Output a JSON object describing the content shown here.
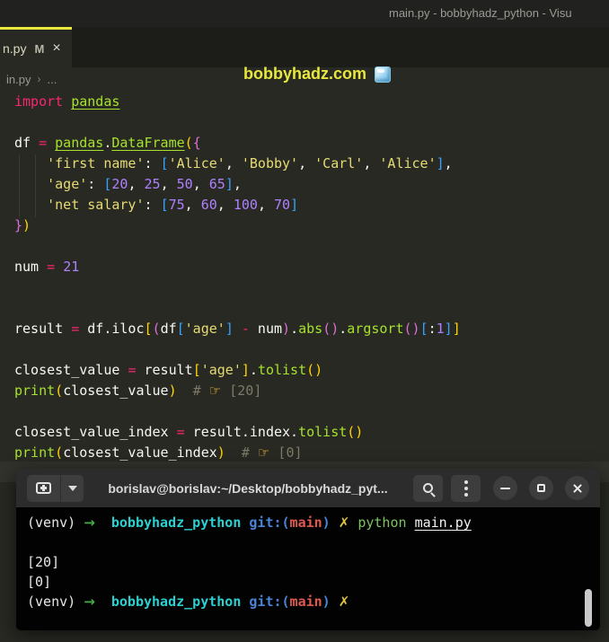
{
  "window": {
    "title": "main.py - bobbyhadz_python - Visu"
  },
  "tab": {
    "label": "n.py",
    "modified_badge": "M",
    "close_glyph": "×"
  },
  "center_title": {
    "text": "bobbyhadz.com",
    "icon": "ice-cube-icon"
  },
  "breadcrumb": {
    "file": "in.py",
    "separator": "›",
    "more": "..."
  },
  "colors": {
    "editor_bg": "#282923",
    "titlebar_bg": "#212220",
    "tabbar_bg": "#1c1d18",
    "tab_accent_yellow": "#e7e73c",
    "watermark_yellow": "#e8e73e",
    "keyword_pink": "#f92672",
    "function_green": "#a6e22e",
    "string_khaki": "#e6db74",
    "number_purple": "#ae81ff",
    "comment_gray": "#7e7a68",
    "bracket_level1_yellow": "#ffd700",
    "bracket_level2_purple": "#d970d6",
    "bracket_level3_blue": "#36a3ff",
    "terminal_bg": "#020202",
    "terminal_header_bg": "#2c2c2c",
    "prompt_arrow_green": "#43b14b",
    "prompt_dir_cyan": "#2bd0d0",
    "prompt_git_blue": "#4a84d4",
    "prompt_branch_red": "#e05a50",
    "prompt_dirty_yellow": "#e2c23f"
  },
  "code": {
    "lines": [
      [
        [
          "kw",
          "import"
        ],
        [
          "pl",
          " "
        ],
        [
          "mod",
          "pandas"
        ]
      ],
      [],
      [
        [
          "pl",
          "df "
        ],
        [
          "op",
          "="
        ],
        [
          "pl",
          " "
        ],
        [
          "mod",
          "pandas"
        ],
        [
          "pl",
          "."
        ],
        [
          "mod",
          "DataFrame"
        ],
        [
          "b1",
          "("
        ],
        [
          "b2",
          "{"
        ]
      ],
      [
        [
          "pl",
          "    "
        ],
        [
          "str",
          "'first name'"
        ],
        [
          "pl",
          ": "
        ],
        [
          "b3",
          "["
        ],
        [
          "str",
          "'Alice'"
        ],
        [
          "pl",
          ", "
        ],
        [
          "str",
          "'Bobby'"
        ],
        [
          "pl",
          ", "
        ],
        [
          "str",
          "'Carl'"
        ],
        [
          "pl",
          ", "
        ],
        [
          "str",
          "'Alice'"
        ],
        [
          "b3",
          "]"
        ],
        [
          "pl",
          ","
        ]
      ],
      [
        [
          "pl",
          "    "
        ],
        [
          "str",
          "'age'"
        ],
        [
          "pl",
          ": "
        ],
        [
          "b3",
          "["
        ],
        [
          "num",
          "20"
        ],
        [
          "pl",
          ", "
        ],
        [
          "num",
          "25"
        ],
        [
          "pl",
          ", "
        ],
        [
          "num",
          "50"
        ],
        [
          "pl",
          ", "
        ],
        [
          "num",
          "65"
        ],
        [
          "b3",
          "]"
        ],
        [
          "pl",
          ","
        ]
      ],
      [
        [
          "pl",
          "    "
        ],
        [
          "str",
          "'net salary'"
        ],
        [
          "pl",
          ": "
        ],
        [
          "b3",
          "["
        ],
        [
          "num",
          "75"
        ],
        [
          "pl",
          ", "
        ],
        [
          "num",
          "60"
        ],
        [
          "pl",
          ", "
        ],
        [
          "num",
          "100"
        ],
        [
          "pl",
          ", "
        ],
        [
          "num",
          "70"
        ],
        [
          "b3",
          "]"
        ]
      ],
      [
        [
          "b2",
          "}"
        ],
        [
          "b1",
          ")"
        ]
      ],
      [],
      [
        [
          "pl",
          "num "
        ],
        [
          "op",
          "="
        ],
        [
          "pl",
          " "
        ],
        [
          "num",
          "21"
        ]
      ],
      [],
      [],
      [
        [
          "pl",
          "result "
        ],
        [
          "op",
          "="
        ],
        [
          "pl",
          " df.iloc"
        ],
        [
          "b1",
          "["
        ],
        [
          "b2",
          "("
        ],
        [
          "pl",
          "df"
        ],
        [
          "b3",
          "["
        ],
        [
          "str",
          "'age'"
        ],
        [
          "b3",
          "]"
        ],
        [
          "pl",
          " "
        ],
        [
          "op",
          "-"
        ],
        [
          "pl",
          " num"
        ],
        [
          "b2",
          ")"
        ],
        [
          "pl",
          "."
        ],
        [
          "fn",
          "abs"
        ],
        [
          "b2",
          "()"
        ],
        [
          "pl",
          "."
        ],
        [
          "fn",
          "argsort"
        ],
        [
          "b2",
          "()"
        ],
        [
          "b3",
          "["
        ],
        [
          "pl",
          ":"
        ],
        [
          "num",
          "1"
        ],
        [
          "b3",
          "]"
        ],
        [
          "b1",
          "]"
        ]
      ],
      [],
      [
        [
          "pl",
          "closest_value "
        ],
        [
          "op",
          "="
        ],
        [
          "pl",
          " result"
        ],
        [
          "b1",
          "["
        ],
        [
          "str",
          "'age'"
        ],
        [
          "b1",
          "]"
        ],
        [
          "pl",
          "."
        ],
        [
          "fn",
          "tolist"
        ],
        [
          "b1",
          "()"
        ]
      ],
      [
        [
          "fn",
          "print"
        ],
        [
          "b1",
          "("
        ],
        [
          "pl",
          "closest_value"
        ],
        [
          "b1",
          ")"
        ],
        [
          "pl",
          "  "
        ],
        [
          "cm",
          "# "
        ],
        [
          "hand",
          "☞"
        ],
        [
          "cm",
          " [20]"
        ]
      ],
      [],
      [
        [
          "pl",
          "closest_value_index "
        ],
        [
          "op",
          "="
        ],
        [
          "pl",
          " result.index."
        ],
        [
          "fn",
          "tolist"
        ],
        [
          "b1",
          "()"
        ]
      ],
      [
        [
          "fn",
          "print"
        ],
        [
          "b1",
          "("
        ],
        [
          "pl",
          "closest_value_index"
        ],
        [
          "b1",
          ")"
        ],
        [
          "pl",
          "  "
        ],
        [
          "cm",
          "# "
        ],
        [
          "hand",
          "☞"
        ],
        [
          "cm",
          " [0]"
        ]
      ]
    ]
  },
  "terminal": {
    "title": "borislav@borislav:~/Desktop/bobbyhadz_pyt...",
    "lines": [
      [
        [
          "w",
          "(venv) "
        ],
        [
          "g",
          "→"
        ],
        [
          "w",
          "  "
        ],
        [
          "cy",
          "bobbyhadz_python"
        ],
        [
          "w",
          " "
        ],
        [
          "bl",
          "git:("
        ],
        [
          "rd",
          "main"
        ],
        [
          "bl",
          ")"
        ],
        [
          "w",
          " "
        ],
        [
          "yl",
          "✗"
        ],
        [
          "w",
          " "
        ],
        [
          "grn",
          "python"
        ],
        [
          "w",
          " "
        ],
        [
          "fu",
          "main.py"
        ]
      ],
      [],
      [
        [
          "w",
          "[20]"
        ]
      ],
      [
        [
          "w",
          "[0]"
        ]
      ],
      [
        [
          "w",
          "(venv) "
        ],
        [
          "g",
          "→"
        ],
        [
          "w",
          "  "
        ],
        [
          "cy",
          "bobbyhadz_python"
        ],
        [
          "w",
          " "
        ],
        [
          "bl",
          "git:("
        ],
        [
          "rd",
          "main"
        ],
        [
          "bl",
          ")"
        ],
        [
          "w",
          " "
        ],
        [
          "yl",
          "✗"
        ]
      ]
    ]
  }
}
